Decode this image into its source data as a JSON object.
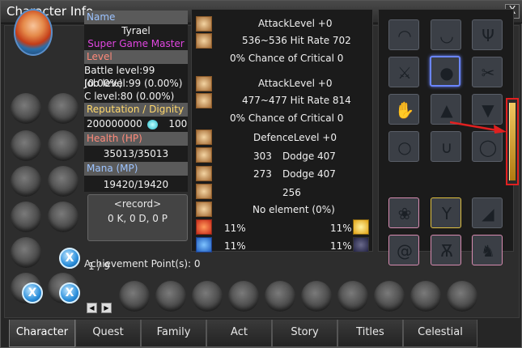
{
  "window": {
    "title": "Character Info",
    "close_label": "X"
  },
  "profile": {
    "name_header": "Name",
    "name": "Tyrael",
    "title": "Super Game Master",
    "level_header": "Level",
    "battle_level": "Battle level:99 (0.00%)",
    "job_level": "Job level:99 (0.00%)",
    "c_level": "C level:80 (0.00%)",
    "reputation_header": "Reputation / Dignity",
    "reputation": "200000000",
    "dignity": "100",
    "health_header": "Health (HP)",
    "health": "35013/35013",
    "mana_header": "Mana (MP)",
    "mana": "19420/19420"
  },
  "record": {
    "label": "<record>",
    "kdp": "0 K, 0 D, 0 P",
    "achievement": "Achievement Point(s): 0"
  },
  "stats": {
    "attack1_level": "AttackLevel +0",
    "attack1_hit": "536~536 Hit Rate 702",
    "attack1_crit": "0% Chance of Critical  0",
    "attack2_level": "AttackLevel +0",
    "attack2_hit": "477~477 Hit Rate 814",
    "attack2_crit": "0% Chance of Critical  0",
    "defence_level": "DefenceLevel +0",
    "def1_value": "303",
    "def1_dodge": "Dodge 407",
    "def2_value": "273",
    "def2_dodge": "Dodge 407",
    "misc_value": "256",
    "element": "No element (0%)",
    "fire_pct": "11%",
    "light_pct": "11%",
    "water_pct": "11%",
    "dark_pct": "11%"
  },
  "pager": {
    "page": "1 / 9",
    "prev": "◀",
    "next": "▶"
  },
  "tabs": [
    {
      "label": "Character"
    },
    {
      "label": "Quest"
    },
    {
      "label": "Family"
    },
    {
      "label": "Act"
    },
    {
      "label": "Story"
    },
    {
      "label": "Titles"
    },
    {
      "label": "Celestial Spire"
    }
  ],
  "colors": {
    "accent_blue": "#9cc3ff",
    "accent_red": "#ff8a7a",
    "accent_yellow": "#ffd86b",
    "title_pink": "#e046e0",
    "highlight_red": "#e02020"
  }
}
